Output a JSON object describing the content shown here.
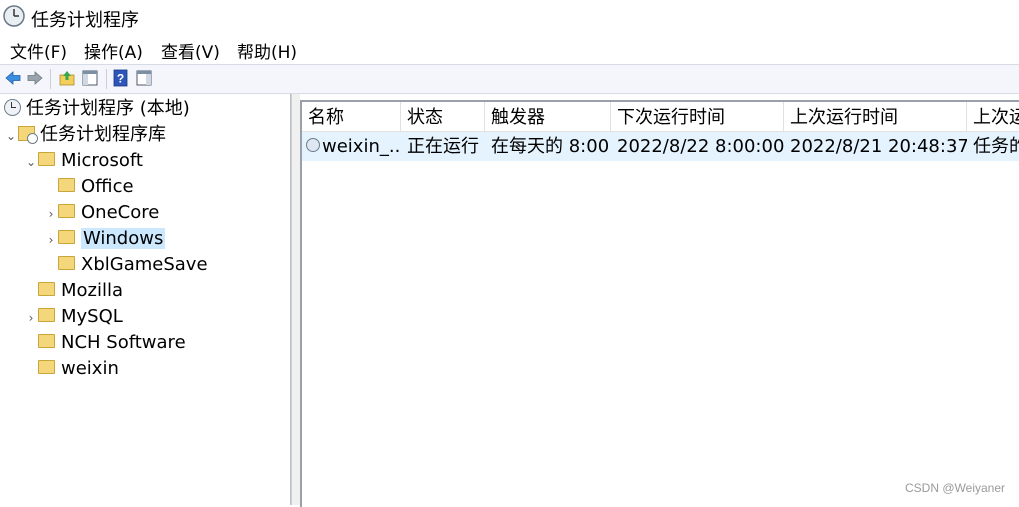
{
  "window": {
    "title": "任务计划程序"
  },
  "menu": [
    "文件(F)",
    "操作(A)",
    "查看(V)",
    "帮助(H)"
  ],
  "toolbar": {
    "icons": [
      "back-arrow-icon",
      "forward-arrow-icon",
      "up-folder-icon",
      "show-hide-console-tree-icon",
      "help-icon",
      "show-hide-action-pane-icon"
    ]
  },
  "tree": {
    "root": "任务计划程序 (本地)",
    "library": "任务计划程序库",
    "items": [
      {
        "label": "Microsoft",
        "expanded": true
      },
      {
        "label": "Office"
      },
      {
        "label": "OneCore",
        "collapsed": true
      },
      {
        "label": "Windows",
        "collapsed": true,
        "selected": true
      },
      {
        "label": "XblGameSave"
      },
      {
        "label": "Mozilla"
      },
      {
        "label": "MySQL",
        "collapsed": true
      },
      {
        "label": "NCH Software"
      },
      {
        "label": "weixin"
      }
    ]
  },
  "table": {
    "columns": [
      "名称",
      "状态",
      "触发器",
      "下次运行时间",
      "上次运行时间",
      "上次运"
    ],
    "rows": [
      {
        "name": "weixin_...",
        "status": "正在运行",
        "trigger": "在每天的 8:00",
        "next_run": "2022/8/22 8:00:00",
        "last_run": "2022/8/21 20:48:37",
        "last_result": "任务的"
      }
    ]
  },
  "watermark": "CSDN @Weiyaner",
  "colors": {
    "selection": "#cce8ff",
    "row_highlight": "#e5f3ff",
    "folder": "#f5d77b"
  }
}
